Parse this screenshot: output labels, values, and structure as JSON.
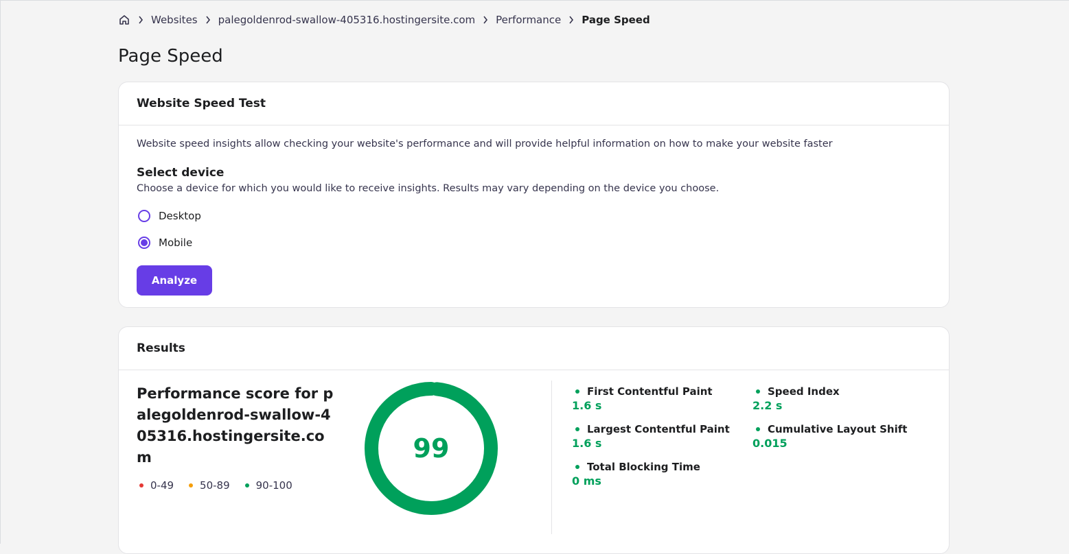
{
  "breadcrumb": {
    "items": [
      "Websites",
      "palegoldenrod-swallow-405316.hostingersite.com",
      "Performance"
    ],
    "current": "Page Speed"
  },
  "page_title": "Page Speed",
  "speed_test": {
    "title": "Website Speed Test",
    "description": "Website speed insights allow checking your website's performance and will provide helpful information on how to make your website faster",
    "select_title": "Select device",
    "select_subtitle": "Choose a device for which you would like to receive insights. Results may vary depending on the device you choose.",
    "options": [
      {
        "label": "Desktop",
        "selected": false
      },
      {
        "label": "Mobile",
        "selected": true
      }
    ],
    "button_label": "Analyze"
  },
  "results": {
    "title": "Results",
    "score_title": "Performance score for palegoldenrod-swallow-405316.hostingersite.com",
    "score": 99,
    "legend": [
      {
        "label": "0-49",
        "color": "#e53935"
      },
      {
        "label": "50-89",
        "color": "#f59e0b"
      },
      {
        "label": "90-100",
        "color": "#00a05b"
      }
    ],
    "metrics": [
      {
        "name": "First Contentful Paint",
        "value": "1.6 s"
      },
      {
        "name": "Speed Index",
        "value": "2.2 s"
      },
      {
        "name": "Largest Contentful Paint",
        "value": "1.6 s"
      },
      {
        "name": "Cumulative Layout Shift",
        "value": "0.015"
      },
      {
        "name": "Total Blocking Time",
        "value": "0 ms"
      }
    ]
  },
  "colors": {
    "accent": "#673de6",
    "good": "#00a05b",
    "average": "#f59e0b",
    "poor": "#e53935"
  },
  "icons": {
    "home": "home-icon",
    "separator": "chevron-right-icon"
  }
}
